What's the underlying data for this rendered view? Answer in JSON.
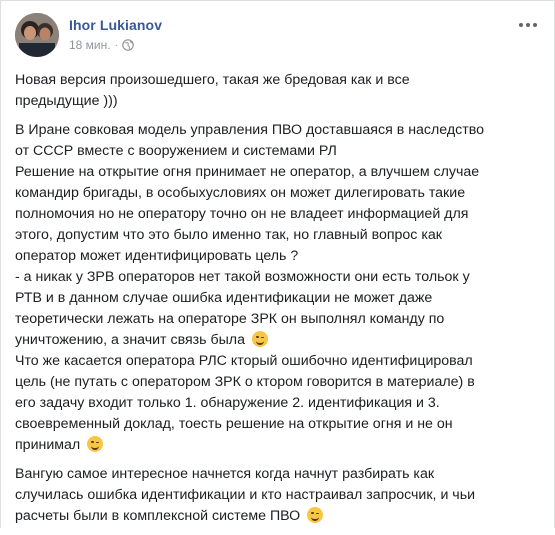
{
  "author": {
    "name": "Ihor Lukianov",
    "time": "18 мин."
  },
  "icons": {
    "privacy": "globe-icon",
    "menu": "more-options-icon",
    "emoji": "wink-emoji-icon"
  },
  "colors": {
    "author_link": "#385898",
    "text": "#1c1e21",
    "meta": "#90949c"
  },
  "post": {
    "p1": [
      "Новая версия произошедшего, такая же бредовая как и все",
      "предыдущие )))"
    ],
    "p2": [
      "В Иране совковая модель управления ПВО доставшаяся в наследство",
      "от СССР вместе с вооружением и системами РЛ",
      "Решение на открытие огня принимает не оператор, а влучшем случае",
      "командир бригады, в особыхусловиях он может дилегировать такие",
      "полномочия но не оператору точно он не владеет информацией для",
      "этого, допустим что это было именно так, но главный вопрос как",
      "оператор может идентифицировать цель ?",
      "- а никак у ЗРВ операторов нет такой возможности они есть тольок у",
      "РТВ и в данном случае ошибка идентификации не может даже",
      "теоретически лежать на операторе ЗРК он выполнял команду по",
      "уничтожению, а значит связь была",
      "Что же касается оператора РЛС кторый ошибочно идентифицировал",
      "цель (не путать с оператором ЗРК о ктором говорится в материале) в",
      "его задачу входит только 1. обнаружение 2. идентификация и 3.",
      "своевременный доклад, тоесть решение на открытие огня и не он",
      "принимал"
    ],
    "p3": [
      "Вангую самое интересное начнется когда начнут разбирать как",
      "случилась ошибка идентификации и кто настраивал запросчик, и чьи",
      "расчеты были в комплексной системе ПВО"
    ]
  }
}
